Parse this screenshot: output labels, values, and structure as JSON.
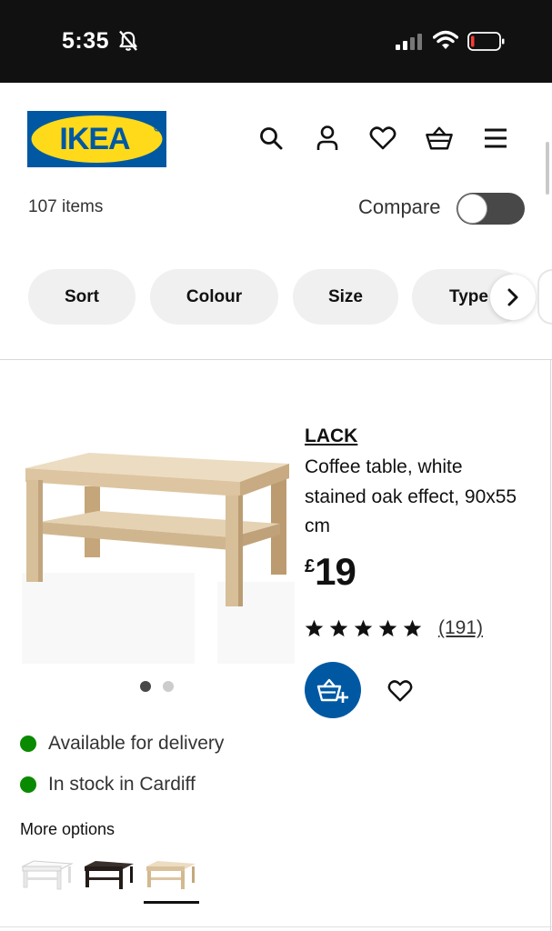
{
  "status_bar": {
    "time": "5:35",
    "icons": [
      "bell-slash-icon",
      "cellular-signal-icon",
      "wifi-icon",
      "battery-low-icon"
    ]
  },
  "header": {
    "logo_text": "IKEA",
    "logo_colors": {
      "blue": "#0058a3",
      "yellow": "#ffda1a"
    },
    "icons": [
      "search-icon",
      "profile-icon",
      "heart-icon",
      "shopping-bag-icon",
      "menu-icon"
    ]
  },
  "results": {
    "count": "107 items",
    "compare_label": "Compare",
    "compare_on": false
  },
  "filters": {
    "items": [
      "Sort",
      "Colour",
      "Size",
      "Type"
    ],
    "next_icon": "chevron-right-icon"
  },
  "product": {
    "name": "LACK",
    "description": "Coffee table, white stained oak effect, 90x55 cm",
    "currency": "£",
    "price": "19",
    "rating": 5,
    "max_rating": 5,
    "review_count": "(191)",
    "image_index": 1,
    "image_count": 2,
    "accent_color": "#0058a3",
    "availability": [
      {
        "text": "Available for delivery",
        "color": "#0a8a00"
      },
      {
        "text": "In stock in Cardiff",
        "color": "#0a8a00"
      }
    ],
    "more_options_label": "More options",
    "variants": [
      {
        "name": "white",
        "color": "#f4f4f2"
      },
      {
        "name": "black-brown",
        "color": "#2a2320"
      },
      {
        "name": "white stained oak effect",
        "color": "#ddc9a8",
        "selected": true
      }
    ]
  }
}
